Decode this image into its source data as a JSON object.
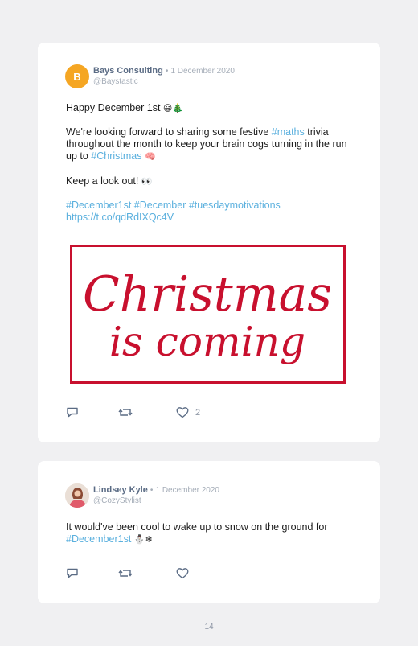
{
  "posts": [
    {
      "author": "Bays Consulting",
      "avatar_letter": "B",
      "separator": "•",
      "date": "1 December 2020",
      "handle": "@Baystastic",
      "lines": {
        "greeting": "Happy December 1st",
        "greeting_emoji": "😃🎄",
        "p1_a": "We're looking forward to sharing some festive ",
        "p1_tag1": "#maths",
        "p1_b": " trivia throughout the month to keep your brain cogs turning in the run up to ",
        "p1_tag2": "#Christmas",
        "p1_emoji": "🧠",
        "p2": "Keep a look out!",
        "p2_emoji": "👀",
        "tags": "#December1st #December #tuesdaymotivations",
        "url": "https://t.co/qdRdIXQc4V"
      },
      "image": {
        "line1": "Christmas",
        "line2": "is coming",
        "color": "#c8102e"
      },
      "likes": "2"
    },
    {
      "author": "Lindsey Kyle",
      "separator": "•",
      "date": "1 December 2020",
      "handle": "@CozyStylist",
      "lines": {
        "text_a": "It would've been cool to wake up to snow on the ground for ",
        "tag": "#December1st",
        "emoji": "⛄❄"
      }
    }
  ],
  "page_number": "14",
  "colors": {
    "link": "#5bb0de",
    "author": "#5a6b84",
    "muted": "#a5adb8",
    "brand_orange": "#f5a623"
  }
}
